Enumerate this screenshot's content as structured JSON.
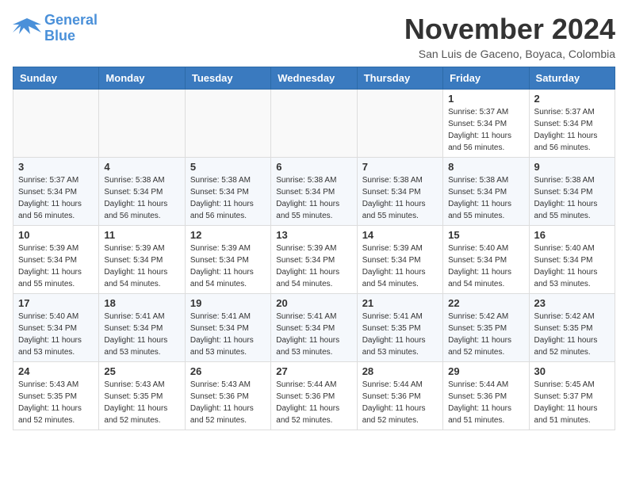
{
  "header": {
    "logo_line1": "General",
    "logo_line2": "Blue",
    "month_title": "November 2024",
    "subtitle": "San Luis de Gaceno, Boyaca, Colombia"
  },
  "weekdays": [
    "Sunday",
    "Monday",
    "Tuesday",
    "Wednesday",
    "Thursday",
    "Friday",
    "Saturday"
  ],
  "weeks": [
    [
      {
        "day": "",
        "info": ""
      },
      {
        "day": "",
        "info": ""
      },
      {
        "day": "",
        "info": ""
      },
      {
        "day": "",
        "info": ""
      },
      {
        "day": "",
        "info": ""
      },
      {
        "day": "1",
        "info": "Sunrise: 5:37 AM\nSunset: 5:34 PM\nDaylight: 11 hours and 56 minutes."
      },
      {
        "day": "2",
        "info": "Sunrise: 5:37 AM\nSunset: 5:34 PM\nDaylight: 11 hours and 56 minutes."
      }
    ],
    [
      {
        "day": "3",
        "info": "Sunrise: 5:37 AM\nSunset: 5:34 PM\nDaylight: 11 hours and 56 minutes."
      },
      {
        "day": "4",
        "info": "Sunrise: 5:38 AM\nSunset: 5:34 PM\nDaylight: 11 hours and 56 minutes."
      },
      {
        "day": "5",
        "info": "Sunrise: 5:38 AM\nSunset: 5:34 PM\nDaylight: 11 hours and 56 minutes."
      },
      {
        "day": "6",
        "info": "Sunrise: 5:38 AM\nSunset: 5:34 PM\nDaylight: 11 hours and 55 minutes."
      },
      {
        "day": "7",
        "info": "Sunrise: 5:38 AM\nSunset: 5:34 PM\nDaylight: 11 hours and 55 minutes."
      },
      {
        "day": "8",
        "info": "Sunrise: 5:38 AM\nSunset: 5:34 PM\nDaylight: 11 hours and 55 minutes."
      },
      {
        "day": "9",
        "info": "Sunrise: 5:38 AM\nSunset: 5:34 PM\nDaylight: 11 hours and 55 minutes."
      }
    ],
    [
      {
        "day": "10",
        "info": "Sunrise: 5:39 AM\nSunset: 5:34 PM\nDaylight: 11 hours and 55 minutes."
      },
      {
        "day": "11",
        "info": "Sunrise: 5:39 AM\nSunset: 5:34 PM\nDaylight: 11 hours and 54 minutes."
      },
      {
        "day": "12",
        "info": "Sunrise: 5:39 AM\nSunset: 5:34 PM\nDaylight: 11 hours and 54 minutes."
      },
      {
        "day": "13",
        "info": "Sunrise: 5:39 AM\nSunset: 5:34 PM\nDaylight: 11 hours and 54 minutes."
      },
      {
        "day": "14",
        "info": "Sunrise: 5:39 AM\nSunset: 5:34 PM\nDaylight: 11 hours and 54 minutes."
      },
      {
        "day": "15",
        "info": "Sunrise: 5:40 AM\nSunset: 5:34 PM\nDaylight: 11 hours and 54 minutes."
      },
      {
        "day": "16",
        "info": "Sunrise: 5:40 AM\nSunset: 5:34 PM\nDaylight: 11 hours and 53 minutes."
      }
    ],
    [
      {
        "day": "17",
        "info": "Sunrise: 5:40 AM\nSunset: 5:34 PM\nDaylight: 11 hours and 53 minutes."
      },
      {
        "day": "18",
        "info": "Sunrise: 5:41 AM\nSunset: 5:34 PM\nDaylight: 11 hours and 53 minutes."
      },
      {
        "day": "19",
        "info": "Sunrise: 5:41 AM\nSunset: 5:34 PM\nDaylight: 11 hours and 53 minutes."
      },
      {
        "day": "20",
        "info": "Sunrise: 5:41 AM\nSunset: 5:34 PM\nDaylight: 11 hours and 53 minutes."
      },
      {
        "day": "21",
        "info": "Sunrise: 5:41 AM\nSunset: 5:35 PM\nDaylight: 11 hours and 53 minutes."
      },
      {
        "day": "22",
        "info": "Sunrise: 5:42 AM\nSunset: 5:35 PM\nDaylight: 11 hours and 52 minutes."
      },
      {
        "day": "23",
        "info": "Sunrise: 5:42 AM\nSunset: 5:35 PM\nDaylight: 11 hours and 52 minutes."
      }
    ],
    [
      {
        "day": "24",
        "info": "Sunrise: 5:43 AM\nSunset: 5:35 PM\nDaylight: 11 hours and 52 minutes."
      },
      {
        "day": "25",
        "info": "Sunrise: 5:43 AM\nSunset: 5:35 PM\nDaylight: 11 hours and 52 minutes."
      },
      {
        "day": "26",
        "info": "Sunrise: 5:43 AM\nSunset: 5:36 PM\nDaylight: 11 hours and 52 minutes."
      },
      {
        "day": "27",
        "info": "Sunrise: 5:44 AM\nSunset: 5:36 PM\nDaylight: 11 hours and 52 minutes."
      },
      {
        "day": "28",
        "info": "Sunrise: 5:44 AM\nSunset: 5:36 PM\nDaylight: 11 hours and 52 minutes."
      },
      {
        "day": "29",
        "info": "Sunrise: 5:44 AM\nSunset: 5:36 PM\nDaylight: 11 hours and 51 minutes."
      },
      {
        "day": "30",
        "info": "Sunrise: 5:45 AM\nSunset: 5:37 PM\nDaylight: 11 hours and 51 minutes."
      }
    ]
  ]
}
